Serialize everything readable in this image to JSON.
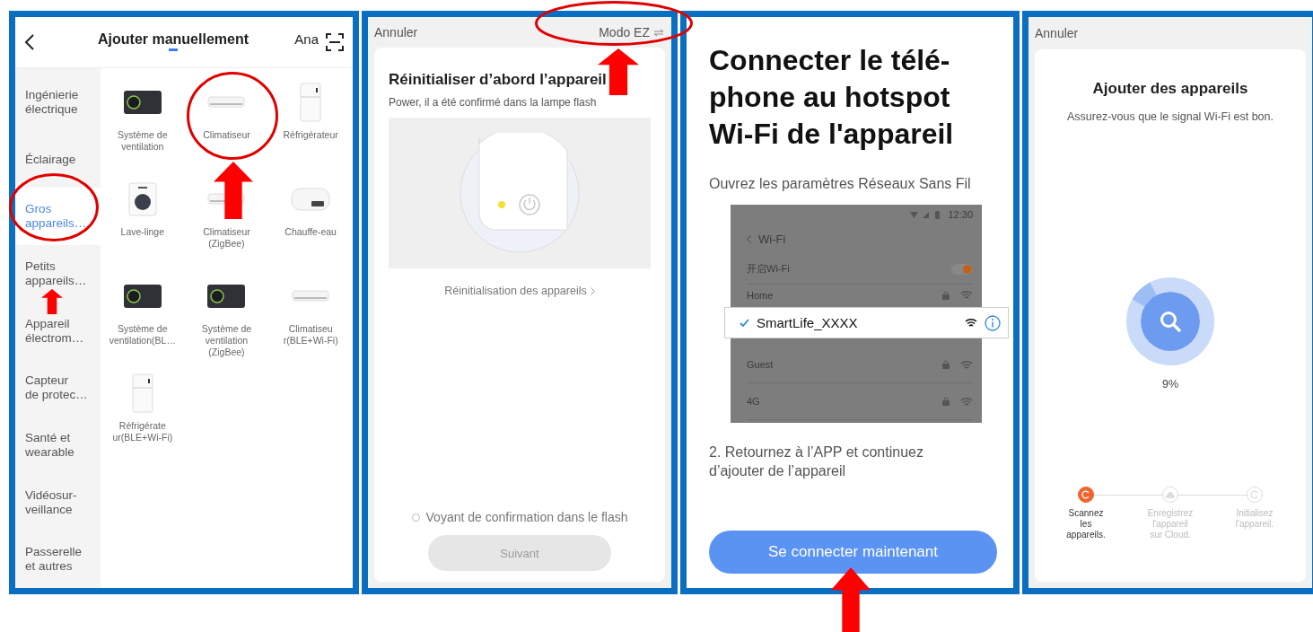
{
  "add_manually": {
    "tabs": [
      {
        "label": "Ajouter manuellement",
        "selected": true
      },
      {
        "label": "Ana",
        "selected": false
      }
    ],
    "categories": [
      {
        "label": "Ingénierie\nélectrique",
        "selected": false
      },
      {
        "label": "Éclairage",
        "selected": false
      },
      {
        "label": "Gros\nappareils…",
        "selected": true
      },
      {
        "label": "Petits\nappareils…",
        "selected": false
      },
      {
        "label": "Appareil\nélectrom…",
        "selected": false
      },
      {
        "label": "Capteur\nde protec…",
        "selected": false
      },
      {
        "label": "Santé et\nwearable",
        "selected": false
      },
      {
        "label": "Vidéosur-\nveillance",
        "selected": false
      },
      {
        "label": "Passerelle\net autres",
        "selected": false
      }
    ],
    "devices": [
      {
        "kind": "ventilation",
        "label": "Système de\nventilation"
      },
      {
        "kind": "aircon",
        "label": "Climatiseur"
      },
      {
        "kind": "fridge",
        "label": "Réfrigérateur"
      },
      {
        "kind": "washer",
        "label": "Lave-linge"
      },
      {
        "kind": "aircon",
        "label": "Climatiseur\n(ZigBee)"
      },
      {
        "kind": "heater",
        "label": "Chauffe-eau"
      },
      {
        "kind": "ventilation",
        "label": "Système de\nventilation(BL…"
      },
      {
        "kind": "ventilation",
        "label": "Système de\nventilation\n(ZigBee)"
      },
      {
        "kind": "aircon",
        "label": "Climatiseu\nr(BLE+Wi-Fi)"
      },
      {
        "kind": "fridge",
        "label": "Réfrigérate\nur(BLE+Wi-Fi)"
      }
    ]
  },
  "reset": {
    "cancel": "Annuler",
    "mode": "Modo EZ",
    "title": "Réinitialiser d’abord l’appareil",
    "subtitle": "Power, il a été confirmé dans la lampe flash",
    "link": "Réinitialisation des appareils",
    "confirm": {
      "label": "Voyant de confirmation dans le flash",
      "checked": false
    },
    "next": {
      "label": "Suivant",
      "disabled": true
    }
  },
  "hotspot": {
    "title_lines": [
      "Connecter le télé-",
      "phone au hotspot",
      "Wi-Fi de l'appareil"
    ],
    "instruction": "Ouvrez les paramètres Réseaux Sans Fil",
    "wifi_screen": {
      "time": "12:30",
      "back": "Wi-Fi",
      "toggle": {
        "label": "开启Wi-Fi",
        "on": true
      },
      "networks": [
        "Home",
        "Guest",
        "4G"
      ],
      "connected": {
        "name": "SmartLife_XXXX",
        "checked": true
      }
    },
    "step": "2. Retournez à l’APP et continuez d’ajouter de l’appareil",
    "button": "Se connecter maintenant"
  },
  "scan": {
    "cancel": "Annuler",
    "title": "Ajouter des appareils",
    "subtitle": "Assurez-vous que le signal Wi-Fi est bon.",
    "progress": {
      "level": 0.09,
      "reading": "9%"
    },
    "steps": [
      {
        "label": "Scannez\nles\nappareils.",
        "kind": "scan",
        "selected": true
      },
      {
        "label": "Enregistrez\nl'appareil\nsur Cloud.",
        "kind": "cloud",
        "selected": false
      },
      {
        "label": "Initialisez\nl'appareil.",
        "kind": "init",
        "selected": false
      }
    ]
  }
}
